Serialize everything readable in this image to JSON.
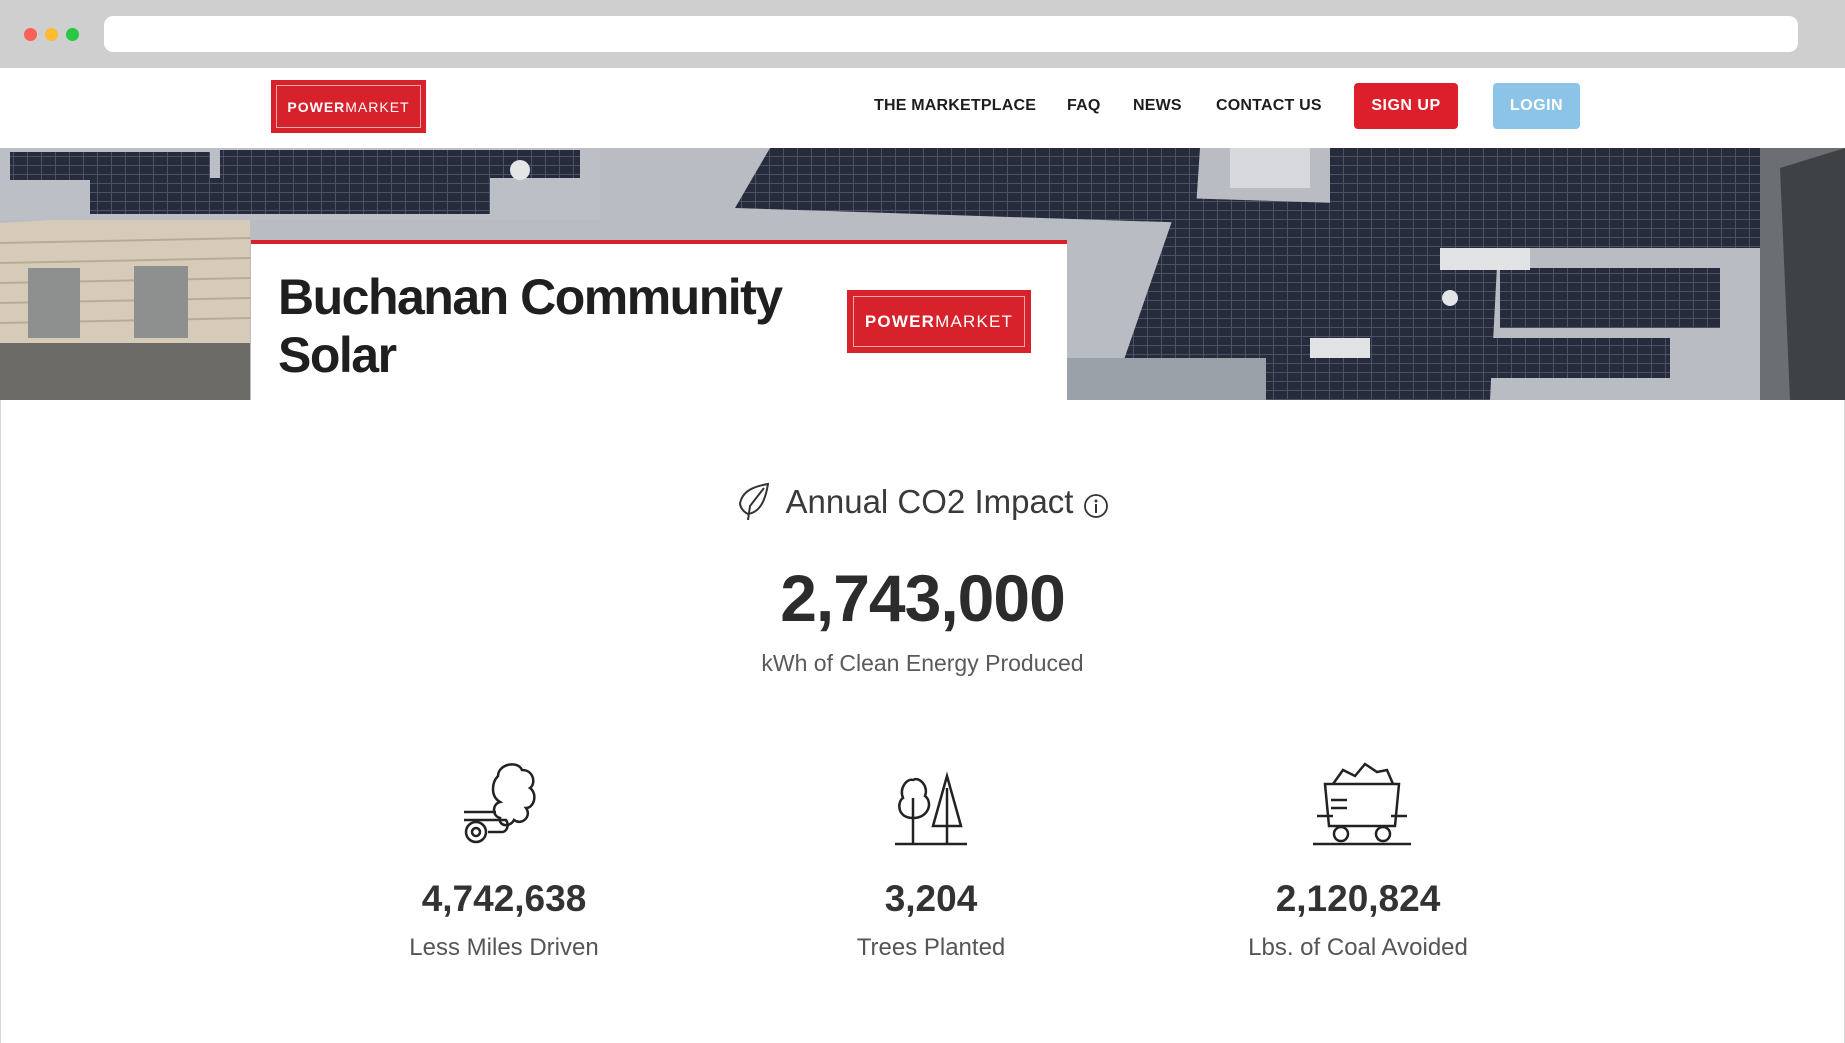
{
  "nav": {
    "logo": {
      "bold": "POWER",
      "light": "MARKET"
    },
    "items": [
      "THE MARKETPLACE",
      "FAQ",
      "NEWS",
      "CONTACT US"
    ],
    "signup_label": "SIGN UP",
    "login_label": "LOGIN"
  },
  "hero": {
    "title": "Buchanan Community Solar",
    "logo": {
      "bold": "POWER",
      "light": "MARKET"
    }
  },
  "impact": {
    "heading": "Annual CO2 Impact",
    "headline_value": "2,743,000",
    "headline_label": "kWh of Clean Energy Produced",
    "stats": [
      {
        "icon": "car-exhaust-icon",
        "value": "4,742,638",
        "label": "Less Miles Driven"
      },
      {
        "icon": "trees-icon",
        "value": "3,204",
        "label": "Trees Planted"
      },
      {
        "icon": "coal-cart-icon",
        "value": "2,120,824",
        "label": "Lbs. of Coal Avoided"
      }
    ]
  },
  "colors": {
    "brand_red": "#d7222b",
    "login_blue": "#8cc4e8",
    "text_dark": "#2c2c2c"
  }
}
